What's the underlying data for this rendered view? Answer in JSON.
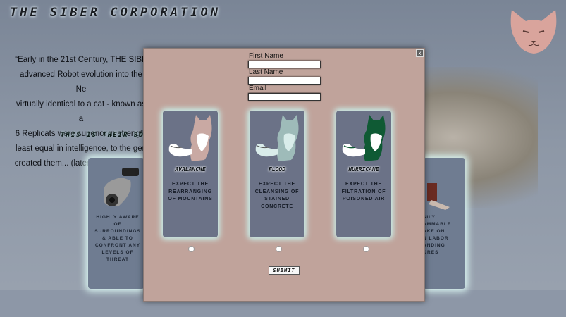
{
  "site": {
    "title": "THE SIBER CORPORATION",
    "intro_lines": [
      "“Early in the 21st Century, THE SIBE",
      "advanced Robot evolution into the Ne",
      "virtually identical to a cat - known as a",
      "6 Replicats were superior in strength",
      "least equal in intelligence, to the gen",
      "created them... (later) Replicats were"
    ],
    "soft_label": "THIS IS THEIR SOFT R"
  },
  "background_cards": {
    "left_lines": [
      "HIGHLY AWARE",
      "OF",
      "SURROUNDINGS",
      "& ABLE TO",
      "CONFRONT ANY",
      "LEVELS OF",
      "THREAT"
    ],
    "right_lines": [
      "SILY",
      "AMMABLE",
      "AKE ON",
      "N LABOR",
      "ANDING",
      "ORES"
    ]
  },
  "modal": {
    "close_label": "x",
    "fields": {
      "first_name_label": "First Name",
      "last_name_label": "Last Name",
      "email_label": "Email"
    },
    "options": [
      {
        "name": "AVALANCHE",
        "desc": "EXPECT THE REARRANGING OF MOUNTAINS",
        "body_color": "#c9a9a3",
        "tail_color": "#ffffff"
      },
      {
        "name": "FLOOD",
        "desc": "EXPECT THE CLEANSING OF STAINED CONCRETE",
        "body_color": "#9ebbb9",
        "tail_color": "#d9ecea"
      },
      {
        "name": "HURRICANE",
        "desc": "EXPECT THE FILTRATION OF POISONED AIR",
        "body_color": "#0f5a34",
        "tail_color": "#ffffff"
      }
    ],
    "submit_label": "SUBMIT"
  },
  "colors": {
    "modal_bg": "#c0a39b",
    "card_bg": "#6b7287",
    "glow": "#c8efea",
    "logo": "#d9a49c"
  }
}
